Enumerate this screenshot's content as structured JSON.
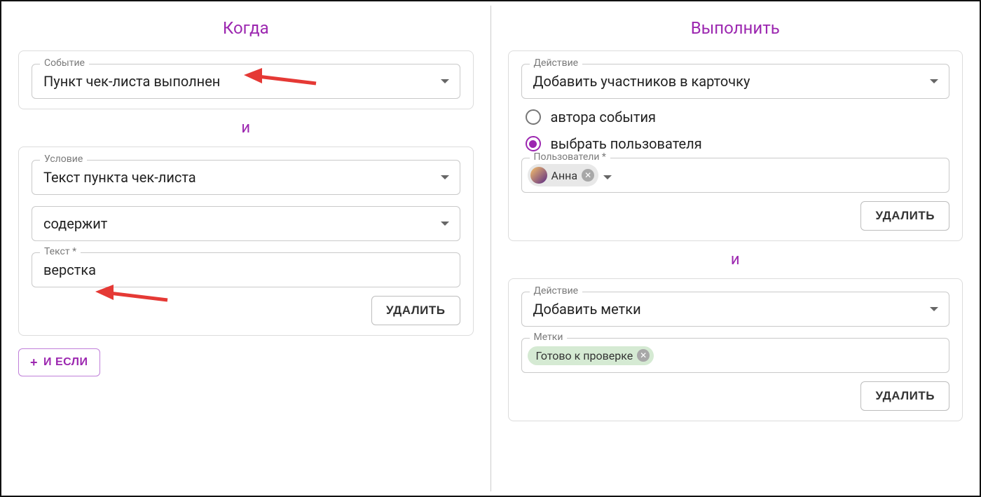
{
  "colors": {
    "accent": "#9c27b0",
    "arrow": "#e53935"
  },
  "left": {
    "title": "Когда",
    "event": {
      "label": "Событие",
      "value": "Пункт чек-листа выполнен"
    },
    "and": "и",
    "condition": {
      "label": "Условие",
      "value": "Текст пункта чек-листа",
      "operator": "содержит",
      "text_label": "Текст *",
      "text_value": "верстка",
      "delete": "УДАЛИТЬ"
    },
    "add_if": "И ЕСЛИ"
  },
  "right": {
    "title": "Выполнить",
    "action1": {
      "label": "Действие",
      "value": "Добавить участников в карточку",
      "radio_author": "автора события",
      "radio_user": "выбрать пользователя",
      "users_label": "Пользователи *",
      "user_chip": "Анна",
      "delete": "УДАЛИТЬ"
    },
    "and": "и",
    "action2": {
      "label": "Действие",
      "value": "Добавить метки",
      "tags_label": "Метки",
      "tag_chip": "Готово к проверке",
      "delete": "УДАЛИТЬ"
    }
  }
}
